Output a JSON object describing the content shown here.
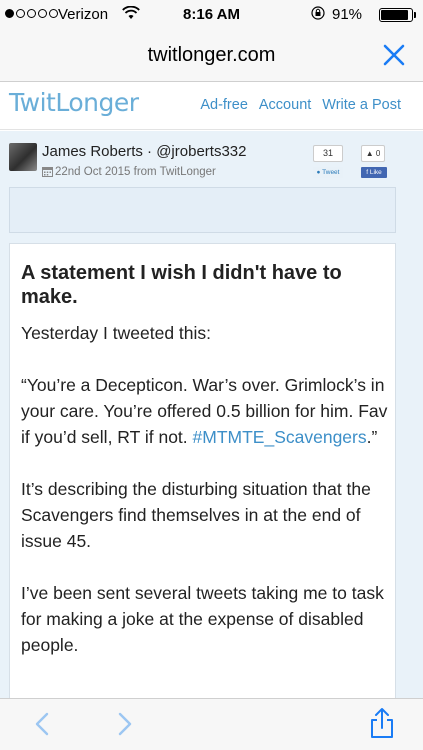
{
  "status_bar": {
    "carrier": "Verizon",
    "time": "8:16 AM",
    "battery": "91%"
  },
  "browser": {
    "url": "twitlonger.com"
  },
  "header": {
    "logo": "TwitLonger",
    "nav": [
      "Ad-free",
      "Account",
      "Write a Post"
    ]
  },
  "author": {
    "name_line": "James Roberts · @jroberts332",
    "meta": "22nd Oct 2015 from TwitLonger"
  },
  "social": {
    "tweet_count": "31",
    "tweet_label": "Tweet",
    "like_count": "0",
    "like_label": "Like"
  },
  "post": {
    "title": "A statement I wish I didn't have to make.",
    "p1": "Yesterday I tweeted this:",
    "p2_quote": "“You’re a Decepticon. War’s over. Grimlock’s in your care. You’re offered 0.5 billion for him. Fav if you’d sell, RT if not.",
    "p2_hashtag": "#MTMTE_Scavengers",
    "p2_end": ".”",
    "p3": "It’s describing the disturbing situation that the Scavengers find themselves in at the end of issue 45.",
    "p4": "I’ve been sent several tweets taking me to task for making a joke at the expense of disabled people."
  },
  "colors": {
    "accent": "#3d8fc8",
    "logo": "#6aaed8",
    "content_bg": "#e9f2f9",
    "ios_blue": "#1a7cf5"
  },
  "icons": {
    "signal": "signal-dots-icon",
    "wifi": "wifi-icon",
    "lock": "rotation-lock-icon",
    "battery": "battery-icon",
    "close": "close-icon",
    "calendar": "calendar-icon",
    "back": "chevron-left-icon",
    "forward": "chevron-right-icon",
    "share": "share-icon"
  }
}
